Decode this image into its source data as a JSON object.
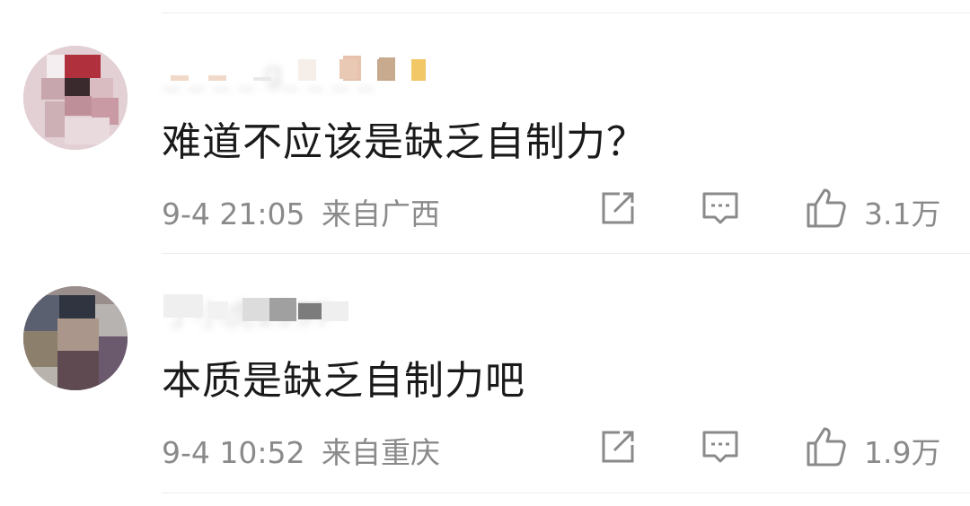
{
  "comments": [
    {
      "username": "_ _ _ _ g_ _ _ _",
      "text": "难道不应该是缺乏自制力？",
      "time": "9-4 21:05",
      "location": "来自广西",
      "likes": "3.1万",
      "icons": {
        "share": "share-icon",
        "reply": "comment-icon",
        "like": "thumbs-up-icon"
      },
      "avatar_colors": [
        "#c9a7ad",
        "#b0303e",
        "#3a2a2e",
        "#e5c9cf"
      ]
    },
    {
      "username": "丁小虎1997",
      "text": "本质是缺乏自制力吧",
      "time": "9-4 10:52",
      "location": "来自重庆",
      "likes": "1.9万",
      "icons": {
        "share": "share-icon",
        "reply": "comment-icon",
        "like": "thumbs-up-icon"
      },
      "avatar_colors": [
        "#2f3440",
        "#6b5a6e",
        "#8c7f6c",
        "#b8b3ad"
      ]
    }
  ],
  "colors": {
    "text_primary": "#1a1a1a",
    "text_secondary": "#8a8a8a",
    "divider": "#ededed"
  }
}
